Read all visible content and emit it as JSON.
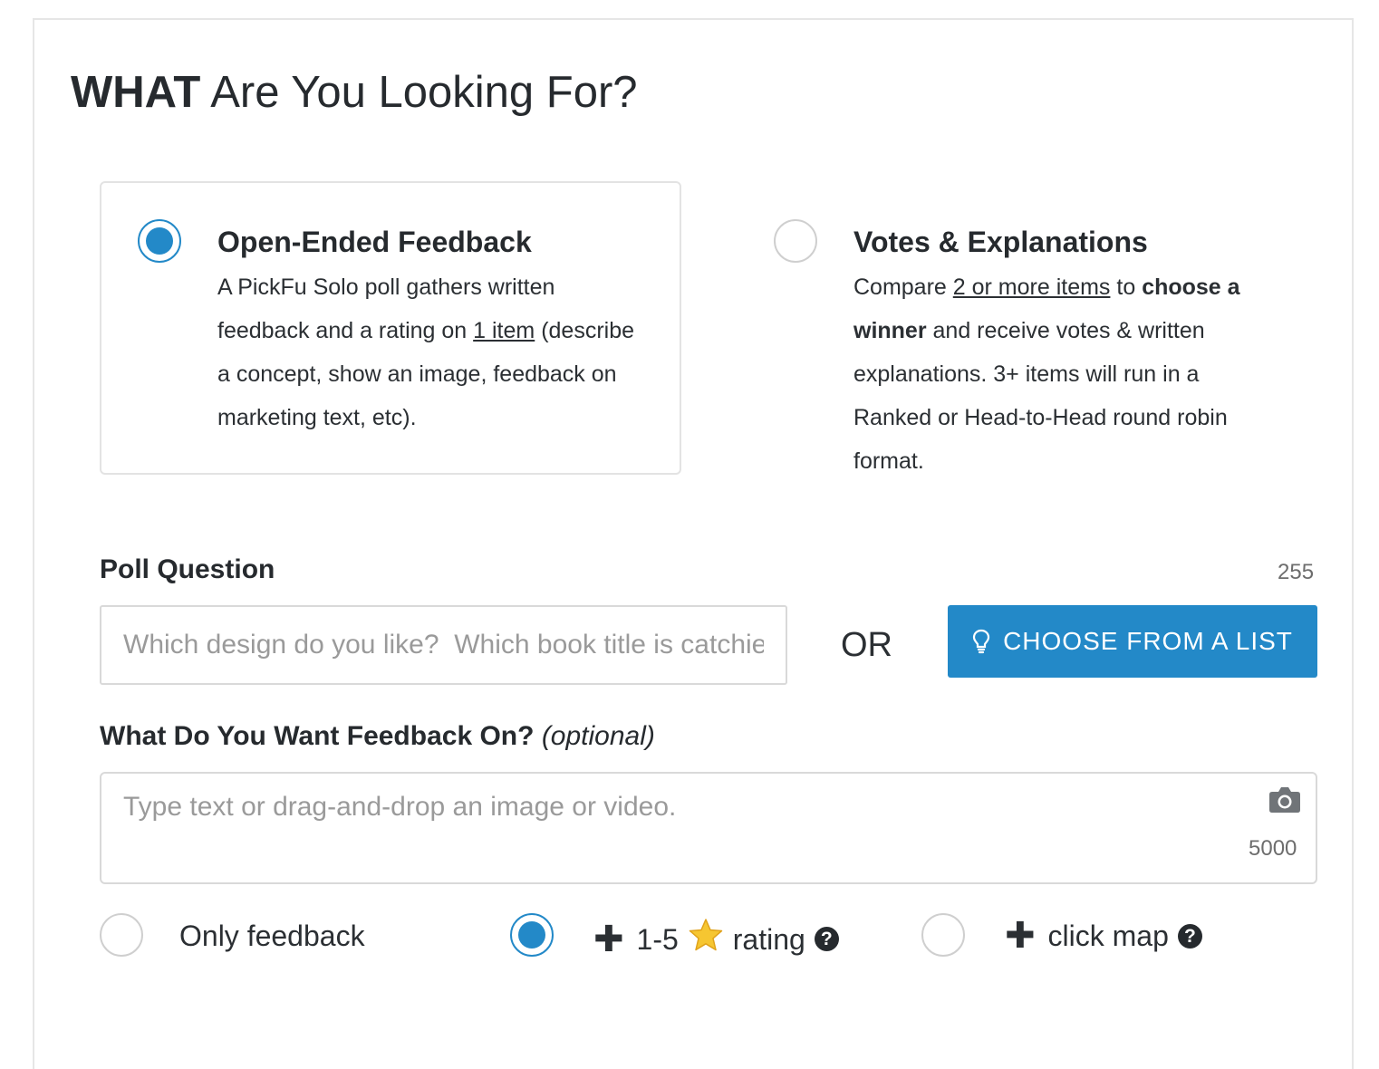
{
  "header": {
    "title_bold": "WHAT",
    "title_rest": " Are You Looking For?"
  },
  "poll_types": [
    {
      "title": "Open-Ended Feedback",
      "selected": true,
      "desc_part1": "A PickFu Solo poll gathers written feedback and a rating on ",
      "desc_link": "1 item",
      "desc_part2": " (describe a concept, show an image, feedback on marketing text, etc)."
    },
    {
      "title": "Votes & Explanations",
      "selected": false,
      "desc_part1": "Compare ",
      "desc_link": "2 or more items",
      "desc_part2": " to ",
      "desc_bold": "choose a winner",
      "desc_part3": " and receive votes & written explanations. 3+ items will run in a Ranked or Head-to-Head round robin format."
    }
  ],
  "poll_question": {
    "label": "Poll Question",
    "counter": "255",
    "placeholder": "Which design do you like?  Which book title is catchier?",
    "or_text": "OR",
    "choose_button": "CHOOSE FROM A LIST"
  },
  "feedback": {
    "label": "What Do You Want Feedback On?",
    "optional": "(optional)",
    "placeholder": "Type text or drag-and-drop an image or video.",
    "counter": "5000"
  },
  "response_options": [
    {
      "label": "Only feedback",
      "selected": false
    },
    {
      "prefix": "1-5",
      "label": "rating",
      "selected": true
    },
    {
      "label": "click map",
      "selected": false
    }
  ],
  "colors": {
    "accent": "#2389c8",
    "star": "#f6c631"
  },
  "icons": {
    "choose_button": "lightbulb-icon",
    "feedback": "camera-icon",
    "help": "question-circle-icon",
    "plus": "plus-icon",
    "rating": "star-icon"
  }
}
